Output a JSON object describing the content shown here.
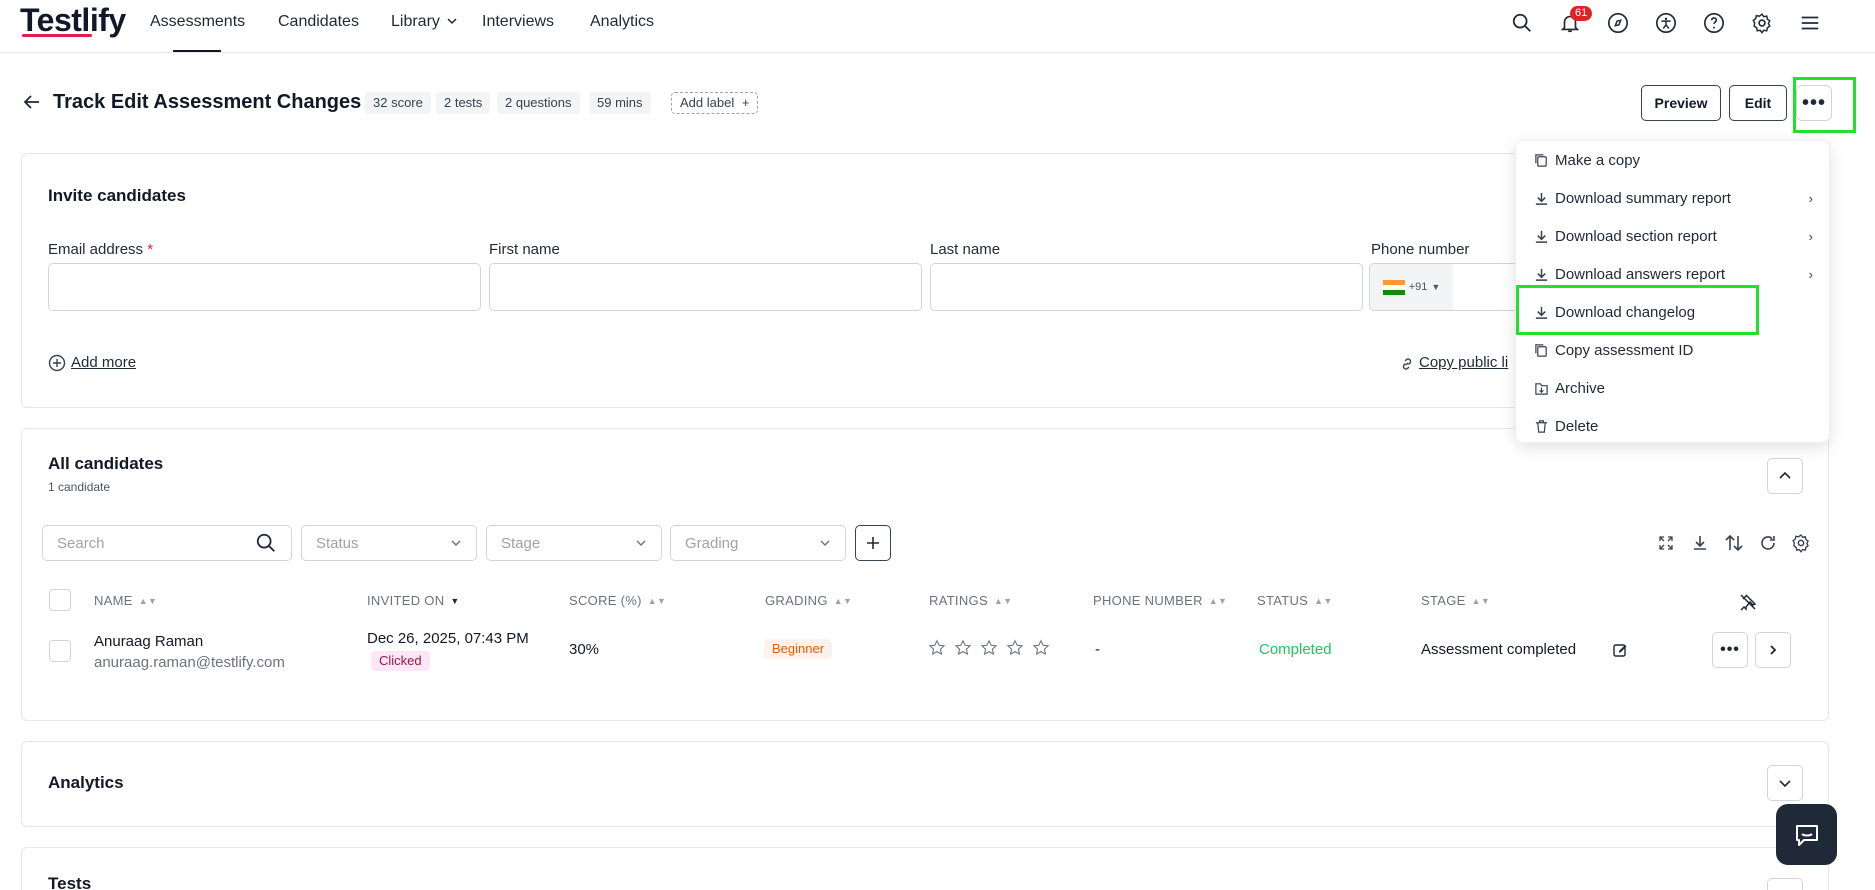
{
  "app": {
    "logo": "Testlify",
    "brand_color": "#e11d48",
    "highlight_color": "#22e12e"
  },
  "nav": {
    "assessments": "Assessments",
    "candidates": "Candidates",
    "library": "Library",
    "interviews": "Interviews",
    "analytics": "Analytics",
    "notification_count": "61"
  },
  "header": {
    "title": "Track Edit Assessment Changes",
    "chips": [
      "32 score",
      "2 tests",
      "2 questions",
      "59 mins"
    ],
    "add_label": "Add label",
    "preview": "Preview",
    "edit": "Edit"
  },
  "invite": {
    "title": "Invite candidates",
    "email_label": "Email address",
    "required_mark": "*",
    "first_name_label": "First name",
    "last_name_label": "Last name",
    "phone_label": "Phone number",
    "phone_code": "+91",
    "add_more": "Add more",
    "copy_public_link": "Copy public li"
  },
  "candidates": {
    "title": "All candidates",
    "count": "1 candidate",
    "search_placeholder": "Search",
    "filters": {
      "status": "Status",
      "stage": "Stage",
      "grading": "Grading"
    },
    "columns": [
      "NAME",
      "INVITED ON",
      "SCORE (%)",
      "GRADING",
      "RATINGS",
      "PHONE NUMBER",
      "STATUS",
      "STAGE"
    ],
    "rows": [
      {
        "name": "Anuraag Raman",
        "email": "anuraag.raman@testlify.com",
        "invited_on": "Dec 26, 2025, 07:43 PM",
        "invite_status": "Clicked",
        "score": "30%",
        "grading": "Beginner",
        "rating_stars": 0,
        "phone": "-",
        "status": "Completed",
        "stage": "Assessment completed"
      }
    ]
  },
  "sections": {
    "analytics": "Analytics",
    "tests": "Tests"
  },
  "menu": {
    "items": [
      {
        "label": "Make a copy",
        "icon": "copy-icon",
        "submenu": false
      },
      {
        "label": "Download summary report",
        "icon": "download-icon",
        "submenu": true
      },
      {
        "label": "Download section report",
        "icon": "download-icon",
        "submenu": true
      },
      {
        "label": "Download answers report",
        "icon": "download-icon",
        "submenu": true
      },
      {
        "label": "Download changelog",
        "icon": "download-icon",
        "submenu": false
      },
      {
        "label": "Copy assessment ID",
        "icon": "copy-icon",
        "submenu": false
      },
      {
        "label": "Archive",
        "icon": "archive-icon",
        "submenu": false
      },
      {
        "label": "Delete",
        "icon": "trash-icon",
        "submenu": false
      }
    ]
  }
}
